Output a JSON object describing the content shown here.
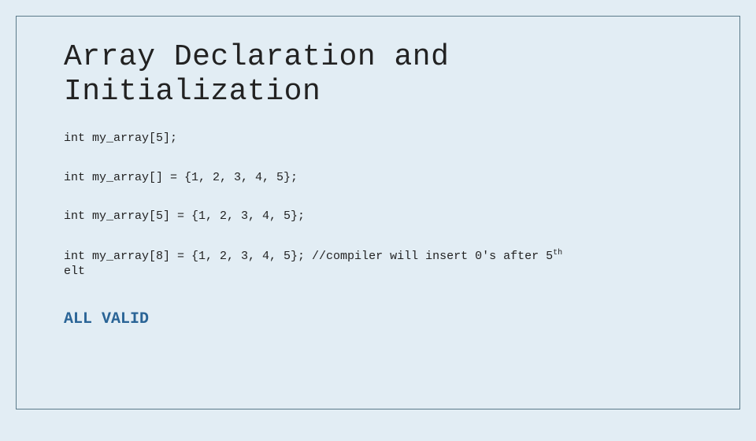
{
  "title": "Array Declaration and\nInitialization",
  "lines": {
    "l1": "int my_array[5];",
    "l2": "int my_array[] = {1, 2, 3, 4, 5};",
    "l3": "int my_array[5] = {1, 2, 3, 4, 5};",
    "l4a": "int my_array[8] = {1, 2, 3, 4, 5}; //compiler will insert 0's after 5",
    "l4sup": "th",
    "l4b": "elt"
  },
  "footer": "ALL VALID"
}
